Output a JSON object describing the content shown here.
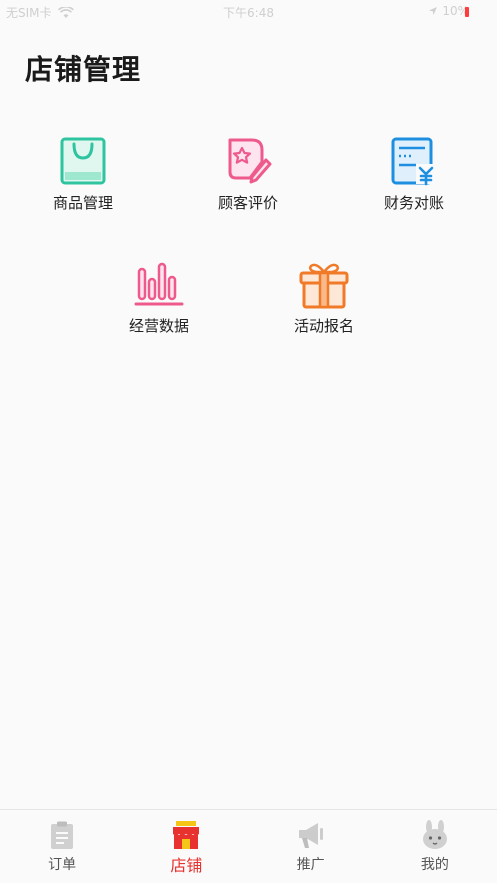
{
  "status_bar": {
    "carrier": "无SIM卡",
    "time": "下午6:48",
    "battery": "10%"
  },
  "page_title": "店铺管理",
  "menu": {
    "items": [
      {
        "label": "商品管理",
        "icon": "shopping-bag-icon",
        "color": "#2ec4a0"
      },
      {
        "label": "顾客评价",
        "icon": "review-edit-icon",
        "color": "#ee5a8c"
      },
      {
        "label": "财务对账",
        "icon": "invoice-yen-icon",
        "color": "#1e8fe0"
      },
      {
        "label": "经营数据",
        "icon": "bar-chart-icon",
        "color": "#ee5a8c"
      },
      {
        "label": "活动报名",
        "icon": "gift-icon",
        "color": "#f07a28"
      }
    ]
  },
  "tabbar": {
    "tabs": [
      {
        "label": "订单",
        "icon": "clipboard-icon"
      },
      {
        "label": "店铺",
        "icon": "storefront-icon",
        "active": true
      },
      {
        "label": "推广",
        "icon": "megaphone-icon"
      },
      {
        "label": "我的",
        "icon": "rabbit-avatar-icon"
      }
    ]
  },
  "colors": {
    "accent": "#e8322f",
    "inactive_icon": "#cccccc"
  }
}
